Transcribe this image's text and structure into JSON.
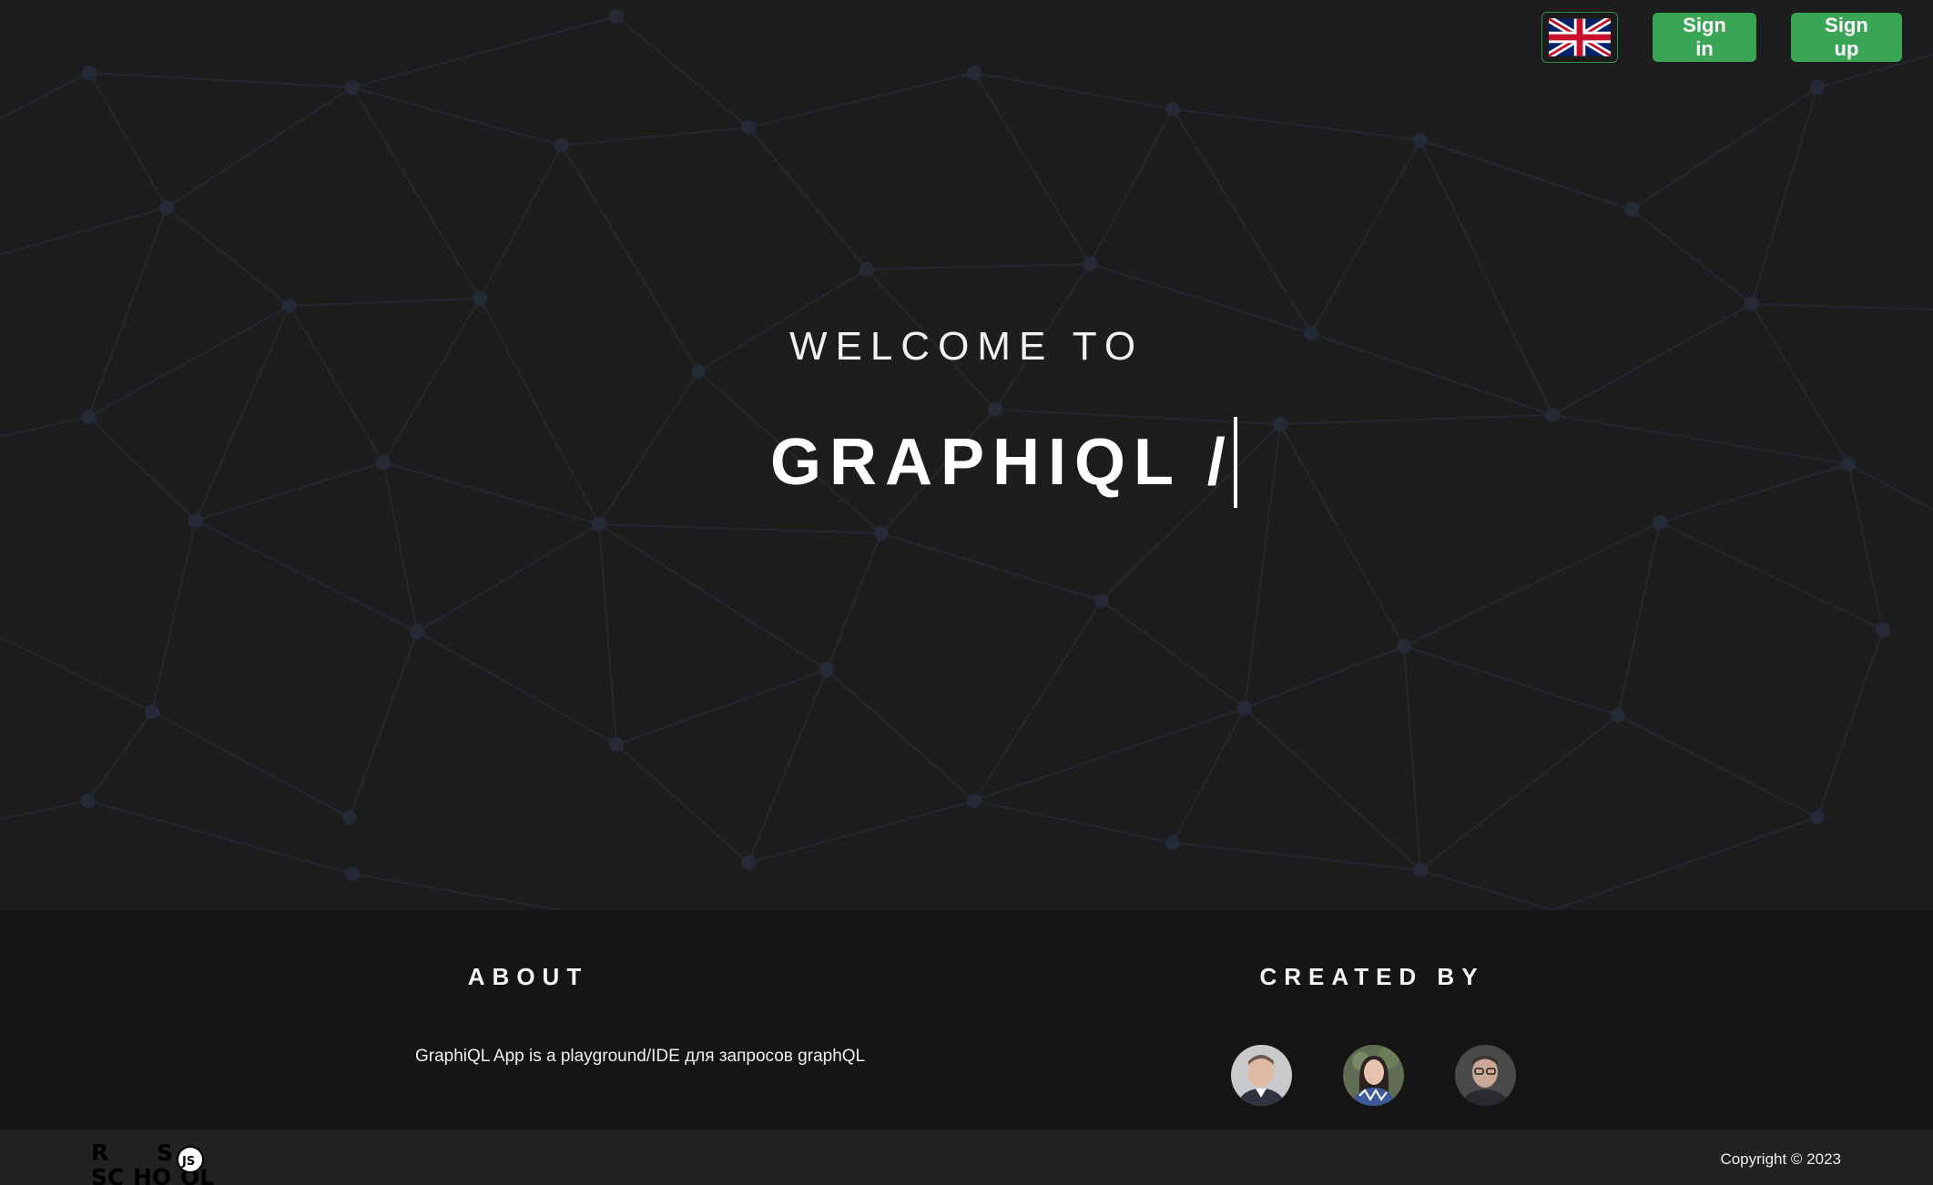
{
  "header": {
    "language_icon": "uk-flag-icon",
    "signin_label": "Sign in",
    "signup_label": "Sign up",
    "accent_color": "#3aa655"
  },
  "hero": {
    "welcome": "WELCOME TO",
    "title": "GRAPHIQL /"
  },
  "footer": {
    "about_title": "ABOUT",
    "about_text": "GraphiQL App is a playground/IDE для запросов graphQL",
    "created_title": "CREATED BY",
    "creators": [
      "avatar-1",
      "avatar-2",
      "avatar-3"
    ],
    "logo_icon": "rs-school-logo-icon",
    "copyright": "Copyright © 2023"
  }
}
